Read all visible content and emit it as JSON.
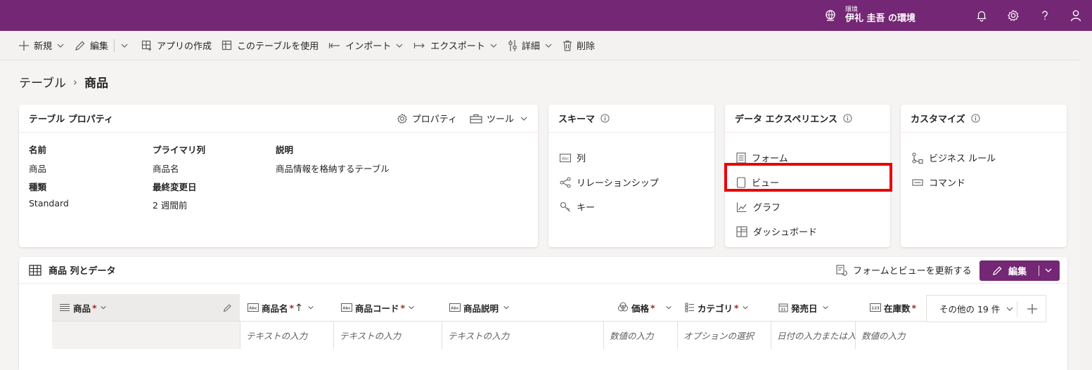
{
  "topbar": {
    "env_label": "環境",
    "env_name": "伊礼 圭吾 の環境",
    "bg": "#742774"
  },
  "commands": [
    {
      "label": "新規",
      "icon": "plus-icon",
      "chevron": true
    },
    {
      "label": "編集",
      "icon": "pencil-icon",
      "chevron": true
    },
    {
      "label": "アプリの作成",
      "icon": "app-add-icon",
      "chevron": false
    },
    {
      "label": "このテーブルを使用",
      "icon": "table-use-icon",
      "chevron": false
    },
    {
      "label": "インポート",
      "icon": "import-icon",
      "chevron": true
    },
    {
      "label": "エクスポート",
      "icon": "export-icon",
      "chevron": true
    },
    {
      "label": "詳細",
      "icon": "settings-sliders-icon",
      "chevron": true
    },
    {
      "label": "削除",
      "icon": "trash-icon",
      "chevron": false
    }
  ],
  "breadcrumb": {
    "parent": "テーブル",
    "current": "商品"
  },
  "properties": {
    "title": "テーブル プロパティ",
    "props_action": "プロパティ",
    "tools_action": "ツール",
    "name_label": "名前",
    "name_value": "商品",
    "primary_label": "プライマリ列",
    "primary_value": "商品名",
    "desc_label": "説明",
    "desc_value": "商品情報を格納するテーブル",
    "type_label": "種類",
    "type_value": "Standard",
    "modified_label": "最終変更日",
    "modified_value": "2 週間前"
  },
  "schema": {
    "title": "スキーマ",
    "items": [
      "列",
      "リレーションシップ",
      "キー"
    ]
  },
  "data_experience": {
    "title": "データ エクスペリエンス",
    "items": [
      "フォーム",
      "ビュー",
      "グラフ",
      "ダッシュボード"
    ]
  },
  "customize": {
    "title": "カスタマイズ",
    "items": [
      "ビジネス ルール",
      "コマンド"
    ]
  },
  "data_section": {
    "title": "商品 列とデータ",
    "refresh": "フォームとビューを更新する",
    "edit": "編集",
    "more_columns": "その他の 19 件",
    "columns": [
      {
        "name": "商品",
        "required": "*",
        "placeholder": ""
      },
      {
        "name": "商品名",
        "required": "*",
        "placeholder": "テキストの入力"
      },
      {
        "name": "商品コード",
        "required": "*",
        "placeholder": "テキストの入力"
      },
      {
        "name": "商品説明",
        "required": "",
        "placeholder": "テキストの入力"
      },
      {
        "name": "価格",
        "required": "*",
        "placeholder": "数値の入力"
      },
      {
        "name": "カテゴリ",
        "required": "*",
        "placeholder": "オプションの選択"
      },
      {
        "name": "発売日",
        "required": "",
        "placeholder": "日付の入力または入"
      },
      {
        "name": "在庫数",
        "required": "*",
        "placeholder": "数値の入力"
      }
    ]
  }
}
